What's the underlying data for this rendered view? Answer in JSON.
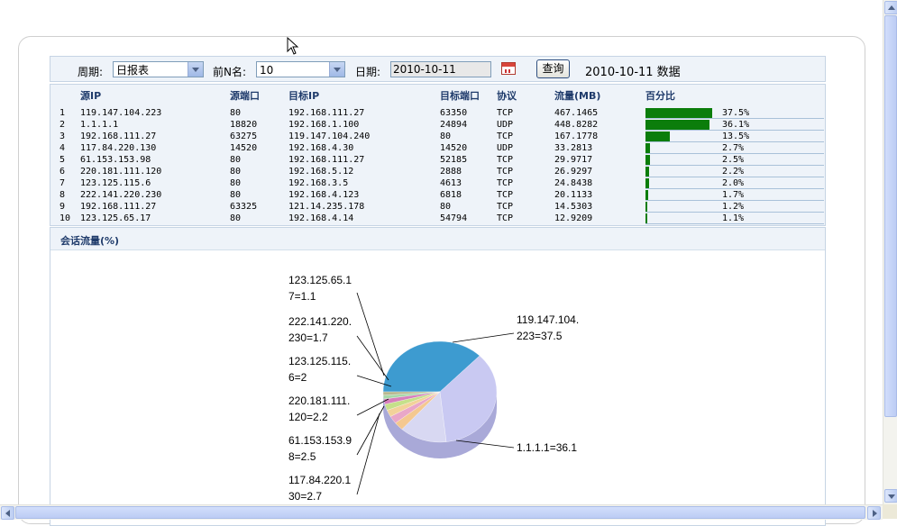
{
  "toolbar": {
    "period_label": "周期:",
    "period_value": "日报表",
    "topn_label": "前N名:",
    "topn_value": "10",
    "date_label": "日期:",
    "date_value": "2010-10-11",
    "query_button": "查询",
    "title": "2010-10-11 数据"
  },
  "table": {
    "headers": [
      "源IP",
      "源端口",
      "目标IP",
      "目标端口",
      "协议",
      "流量(MB)",
      "百分比"
    ],
    "rows": [
      {
        "idx": "1",
        "src_ip": "119.147.104.223",
        "src_port": "80",
        "dst_ip": "192.168.111.27",
        "dst_port": "63350",
        "proto": "TCP",
        "traffic": "467.1465",
        "pct": "37.5%",
        "pct_value": 37.5
      },
      {
        "idx": "2",
        "src_ip": "1.1.1.1",
        "src_port": "18820",
        "dst_ip": "192.168.1.100",
        "dst_port": "24894",
        "proto": "UDP",
        "traffic": "448.8282",
        "pct": "36.1%",
        "pct_value": 36.1
      },
      {
        "idx": "3",
        "src_ip": "192.168.111.27",
        "src_port": "63275",
        "dst_ip": "119.147.104.240",
        "dst_port": "80",
        "proto": "TCP",
        "traffic": "167.1778",
        "pct": "13.5%",
        "pct_value": 13.5
      },
      {
        "idx": "4",
        "src_ip": "117.84.220.130",
        "src_port": "14520",
        "dst_ip": "192.168.4.30",
        "dst_port": "14520",
        "proto": "UDP",
        "traffic": "33.2813",
        "pct": "2.7%",
        "pct_value": 2.7
      },
      {
        "idx": "5",
        "src_ip": "61.153.153.98",
        "src_port": "80",
        "dst_ip": "192.168.111.27",
        "dst_port": "52185",
        "proto": "TCP",
        "traffic": "29.9717",
        "pct": "2.5%",
        "pct_value": 2.5
      },
      {
        "idx": "6",
        "src_ip": "220.181.111.120",
        "src_port": "80",
        "dst_ip": "192.168.5.12",
        "dst_port": "2888",
        "proto": "TCP",
        "traffic": "26.9297",
        "pct": "2.2%",
        "pct_value": 2.2
      },
      {
        "idx": "7",
        "src_ip": "123.125.115.6",
        "src_port": "80",
        "dst_ip": "192.168.3.5",
        "dst_port": "4613",
        "proto": "TCP",
        "traffic": "24.8438",
        "pct": "2.0%",
        "pct_value": 2.0
      },
      {
        "idx": "8",
        "src_ip": "222.141.220.230",
        "src_port": "80",
        "dst_ip": "192.168.4.123",
        "dst_port": "6818",
        "proto": "TCP",
        "traffic": "20.1133",
        "pct": "1.7%",
        "pct_value": 1.7
      },
      {
        "idx": "9",
        "src_ip": "192.168.111.27",
        "src_port": "63325",
        "dst_ip": "121.14.235.178",
        "dst_port": "80",
        "proto": "TCP",
        "traffic": "14.5303",
        "pct": "1.2%",
        "pct_value": 1.2
      },
      {
        "idx": "10",
        "src_ip": "123.125.65.17",
        "src_port": "80",
        "dst_ip": "192.168.4.14",
        "dst_port": "54794",
        "proto": "TCP",
        "traffic": "12.9209",
        "pct": "1.1%",
        "pct_value": 1.1
      }
    ]
  },
  "section": {
    "title": "会话流量(%)"
  },
  "chart_data": {
    "type": "pie",
    "labels_visible": [
      [
        "119.147.104.",
        "223=37.5"
      ],
      [
        "1.1.1.1=36.1"
      ],
      [
        "123.125.65.1",
        "7=1.1"
      ],
      [
        "222.141.220.",
        "230=1.7"
      ],
      [
        "123.125.115.",
        "6=2"
      ],
      [
        "220.181.111.",
        "120=2.2"
      ],
      [
        "61.153.153.9",
        "8=2.5"
      ],
      [
        "117.84.220.1",
        "30=2.7"
      ]
    ],
    "series": [
      {
        "name": "119.147.104.223",
        "value": 37.5,
        "color": "#3d9bd0"
      },
      {
        "name": "1.1.1.1",
        "value": 36.1,
        "color": "#c9c9f2"
      },
      {
        "name": "192.168.111.27",
        "value": 13.5,
        "color": "#d8d8f2"
      },
      {
        "name": "117.84.220.130",
        "value": 2.7,
        "color": "#f4c890"
      },
      {
        "name": "61.153.153.98",
        "value": 2.5,
        "color": "#e9a7c8"
      },
      {
        "name": "220.181.111.120",
        "value": 2.2,
        "color": "#f2d29a"
      },
      {
        "name": "123.125.115.6",
        "value": 2.0,
        "color": "#c5e08a"
      },
      {
        "name": "222.141.220.230",
        "value": 1.7,
        "color": "#d77fbd"
      },
      {
        "name": "192.168.111.27",
        "value": 1.2,
        "color": "#a8d8a8"
      },
      {
        "name": "123.125.65.17",
        "value": 1.1,
        "color": "#b8b890"
      }
    ]
  },
  "colors": {
    "bar": "#0b7d0b",
    "header_text": "#1f3b6b",
    "panel_bg": "#eef3f9"
  }
}
